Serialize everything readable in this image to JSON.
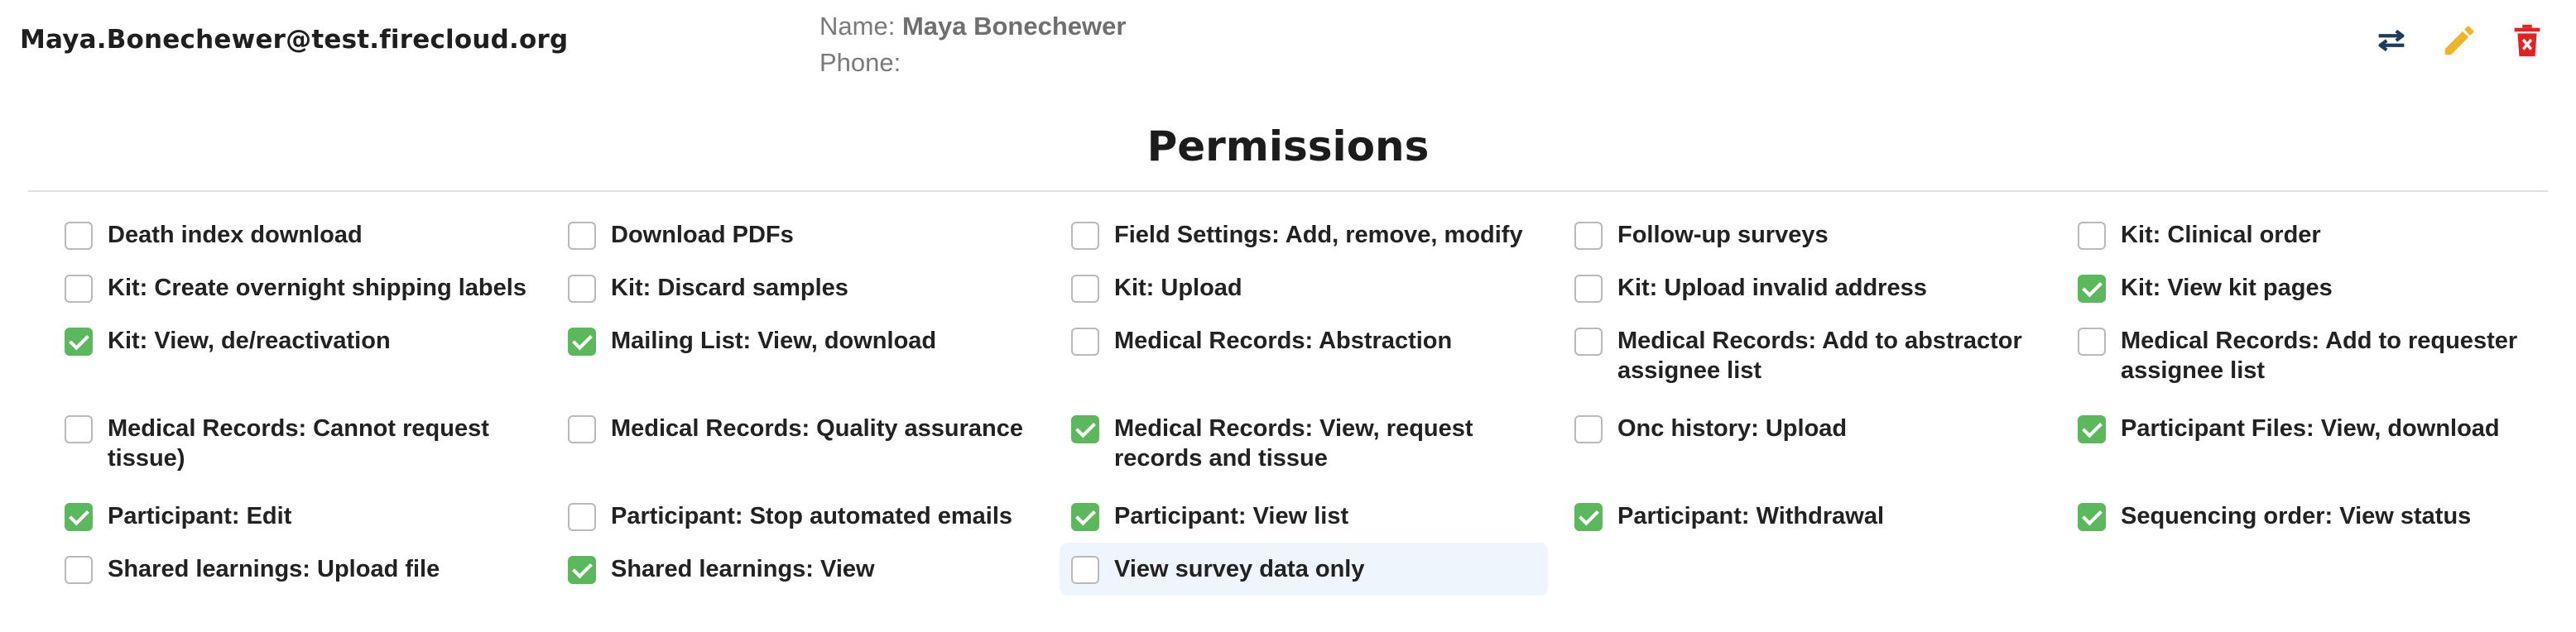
{
  "user": {
    "email": "Maya.Bonechewer@test.firecloud.org",
    "name_label": "Name:",
    "name_value": "Maya Bonechewer",
    "phone_label": "Phone:",
    "phone_value": ""
  },
  "actions": [
    {
      "name": "swap-arrows-icon",
      "color": "#1f3d5a"
    },
    {
      "name": "pencil-icon",
      "color": "#f0b429"
    },
    {
      "name": "delete-icon",
      "color": "#e02424"
    }
  ],
  "permissions_title": "Permissions",
  "permissions": [
    {
      "label": "Death index download",
      "checked": false
    },
    {
      "label": "Download PDFs",
      "checked": false
    },
    {
      "label": "Field Settings: Add, remove, modify",
      "checked": false
    },
    {
      "label": "Follow-up surveys",
      "checked": false
    },
    {
      "label": "Kit: Clinical order",
      "checked": false
    },
    {
      "label": "Kit: Create overnight shipping labels",
      "checked": false
    },
    {
      "label": "Kit: Discard samples",
      "checked": false
    },
    {
      "label": "Kit: Upload",
      "checked": false
    },
    {
      "label": "Kit: Upload invalid address",
      "checked": false
    },
    {
      "label": "Kit: View kit pages",
      "checked": true
    },
    {
      "label": "Kit: View, de/reactivation",
      "checked": true
    },
    {
      "label": "Mailing List: View, download",
      "checked": true
    },
    {
      "label": "Medical Records: Abstraction",
      "checked": false
    },
    {
      "label": "Medical Records: Add to abstractor assignee list",
      "checked": false
    },
    {
      "label": "Medical Records: Add to requester assignee list",
      "checked": false
    },
    {
      "label": "Medical Records: Cannot request tissue)",
      "checked": false
    },
    {
      "label": "Medical Records: Quality assurance",
      "checked": false
    },
    {
      "label": "Medical Records: View, request records and tissue",
      "checked": true
    },
    {
      "label": "Onc history: Upload",
      "checked": false
    },
    {
      "label": "Participant Files: View, download",
      "checked": true
    },
    {
      "label": "Participant: Edit",
      "checked": true
    },
    {
      "label": "Participant: Stop automated emails",
      "checked": false
    },
    {
      "label": "Participant: View list",
      "checked": true
    },
    {
      "label": "Participant: Withdrawal",
      "checked": true
    },
    {
      "label": "Sequencing order: View status",
      "checked": true
    },
    {
      "label": "Shared learnings: Upload file",
      "checked": false
    },
    {
      "label": "Shared learnings: View",
      "checked": true
    },
    {
      "label": "View survey data only",
      "checked": false,
      "highlighted": true
    }
  ],
  "colors": {
    "checkbox_checked": "#5cb85c",
    "checkbox_border": "#b9b9b9",
    "hover_row": "#eef5fd"
  }
}
